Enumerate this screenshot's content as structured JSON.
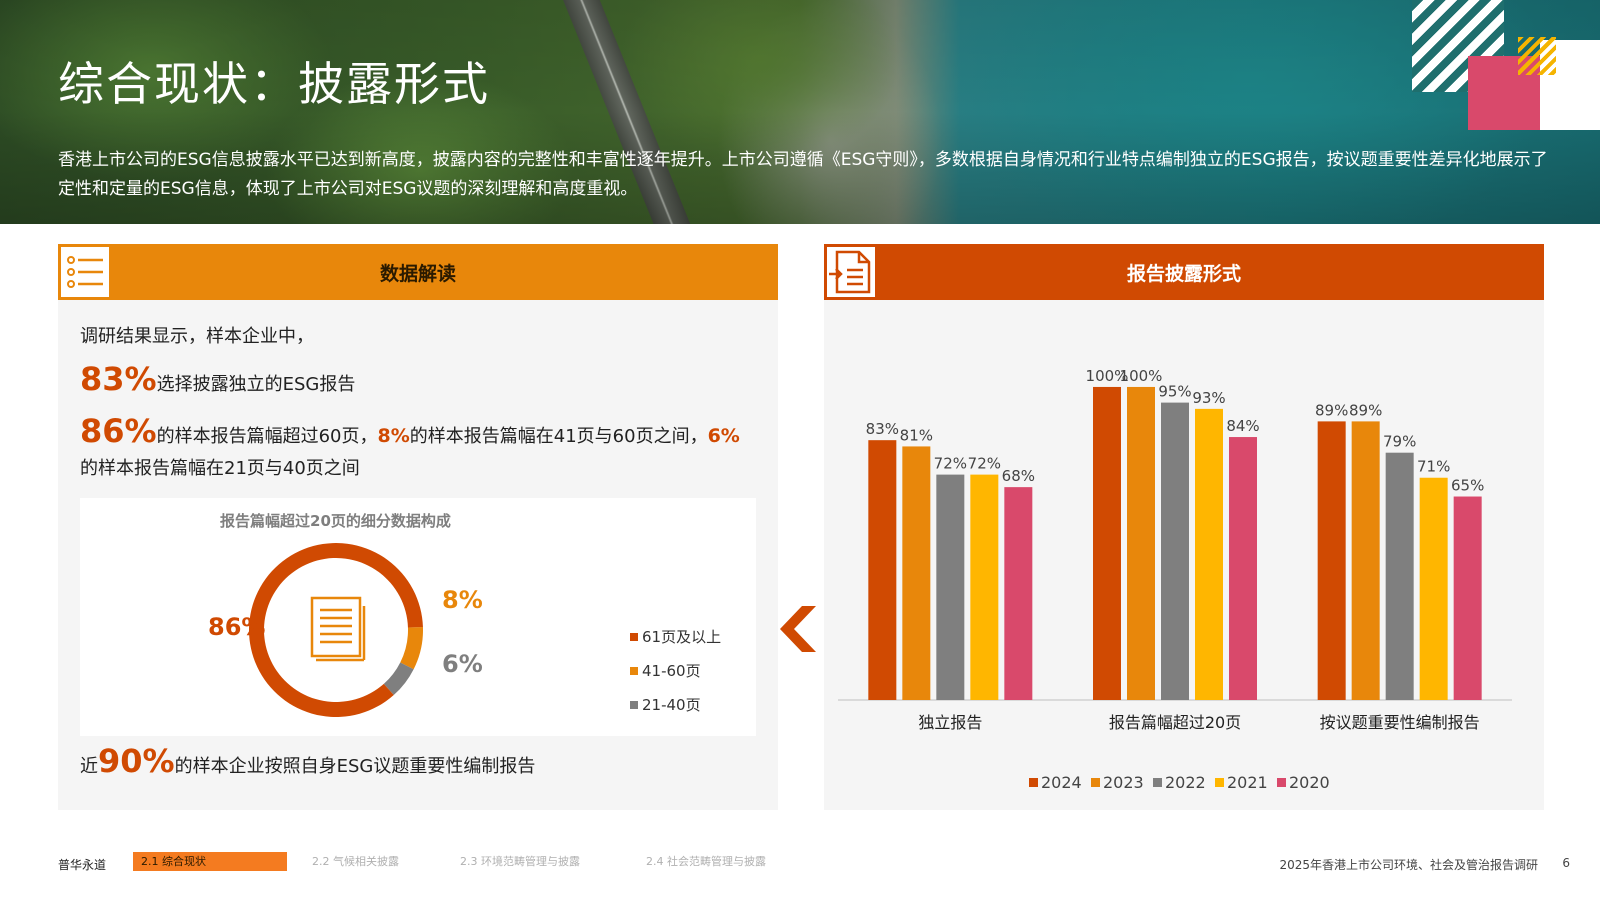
{
  "header": {
    "title": "综合现状：披露形式",
    "intro": "香港上市公司的ESG信息披露水平已达到新高度，披露内容的完整性和丰富性逐年提升。上市公司遵循《ESG守则》，多数根据自身情况和行业特点编制独立的ESG报告，按议题重要性差异化地展示了定性和定量的ESG信息，体现了上市公司对ESG议题的深刻理解和高度重视。"
  },
  "left_panel": {
    "title": "数据解读",
    "lead": "调研结果显示，样本企业中，",
    "stat1_value": "83%",
    "stat1_text": "选择披露独立的ESG报告",
    "stat2_value": "86%",
    "stat2_text_a": "的样本报告篇幅超过60页，",
    "stat2_value_b": "8%",
    "stat2_text_b": "的样本报告篇幅在41页与60页之间，",
    "stat2_value_c": "6%",
    "stat2_text_c": "的样本报告篇幅在21页与40页之间",
    "stat3_prefix": "近",
    "stat3_value": "90%",
    "stat3_text": "的样本企业按照自身ESG议题重要性编制报告",
    "donut": {
      "title": "报告篇幅超过20页的细分数据构成",
      "segments": [
        {
          "label": "61页及以上",
          "value": 86,
          "display": "86%",
          "color": "#d04a02"
        },
        {
          "label": "41-60页",
          "value": 8,
          "display": "8%",
          "color": "#e8870b"
        },
        {
          "label": "21-40页",
          "value": 6,
          "display": "6%",
          "color": "#7f7f7f"
        }
      ]
    }
  },
  "right_panel": {
    "title": "报告披露形式"
  },
  "chart_data": {
    "type": "bar",
    "categories": [
      "独立报告",
      "报告篇幅超过20页",
      "按议题重要性编制报告"
    ],
    "series": [
      {
        "name": "2024",
        "values": [
          83,
          100,
          89
        ],
        "color": "#d04a02"
      },
      {
        "name": "2023",
        "values": [
          81,
          100,
          89
        ],
        "color": "#e8870b"
      },
      {
        "name": "2022",
        "values": [
          72,
          95,
          79
        ],
        "color": "#7f7f7f"
      },
      {
        "name": "2021",
        "values": [
          72,
          93,
          71
        ],
        "color": "#ffb600"
      },
      {
        "name": "2020",
        "values": [
          68,
          84,
          65
        ],
        "color": "#d9496b"
      }
    ],
    "value_suffix": "%",
    "ylim": [
      0,
      115
    ],
    "legend": "bottom",
    "grid": false
  },
  "footer": {
    "brand": "普华永道",
    "tabs": [
      {
        "label": "2.1  综合现状",
        "active": true
      },
      {
        "label": "2.2  气候相关披露",
        "active": false
      },
      {
        "label": "2.3  环境范畴管理与披露",
        "active": false
      },
      {
        "label": "2.4  社会范畴管理与披露",
        "active": false
      }
    ],
    "report_title": "2025年香港上市公司环境、社会及管治报告调研",
    "page_number": "6"
  }
}
